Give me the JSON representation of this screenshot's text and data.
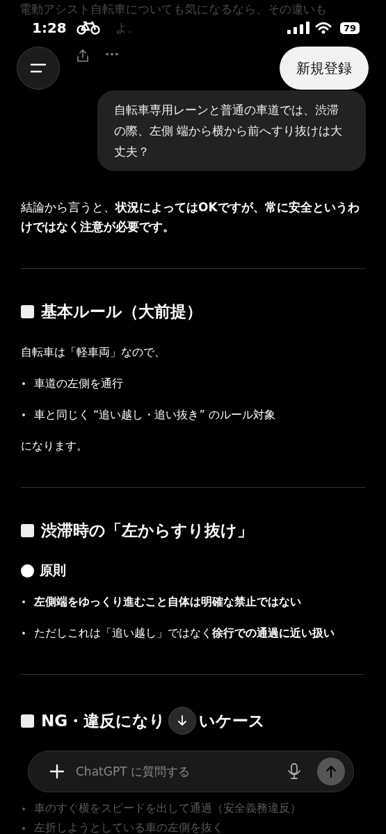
{
  "background_text": {
    "line_1": "電動アシスト自転車についても気になるなら、その違いも",
    "line_2_fragment": "よ。"
  },
  "status_bar": {
    "time": "1:28",
    "battery": "79"
  },
  "top_bar": {
    "signup_button": "新規登録"
  },
  "user_message": "自転車専用レーンと普通の車道では、渋滞の際、左側 端から横から前へすり抜けは大丈夫？",
  "answer": {
    "intro": "結論から言うと、**状況によってはOKですが、常に安全というわけではなく注意が必要です。**",
    "sections": [
      {
        "heading_parts": [
          "基本ルール（大前提）"
        ],
        "blocks": [
          {
            "kind": "paragraph",
            "text": "自転車は「軽車両」なので、"
          },
          {
            "kind": "bullet",
            "text": "車道の左側を通行"
          },
          {
            "kind": "bullet",
            "text": "車と同じく “追い越し・追い抜き” のルール対象"
          },
          {
            "kind": "paragraph",
            "text": "になります。"
          }
        ]
      },
      {
        "heading_parts": [
          "渋滞時の「左からすり抜け」"
        ],
        "blocks": [
          {
            "kind": "subheading",
            "text": "原則"
          },
          {
            "kind": "bullet",
            "text": "**左側端をゆっくり進むこと自体は明確な禁止ではない**"
          },
          {
            "kind": "bullet",
            "text": "ただしこれは「追い越し」ではなく**徐行での通過に近い扱い**"
          }
        ]
      },
      {
        "heading_parts": [
          "NG・違反になり",
          "いケース"
        ],
        "blocks": [
          {
            "kind": "faded_bullet",
            "text": "車のすぐ横をスピードを出して通過（安全義務違反）"
          },
          {
            "kind": "faded_bullet",
            "text": "左折しようとしている車の左側を抜く"
          }
        ]
      }
    ]
  },
  "composer": {
    "placeholder": "ChatGPT に質問する"
  }
}
